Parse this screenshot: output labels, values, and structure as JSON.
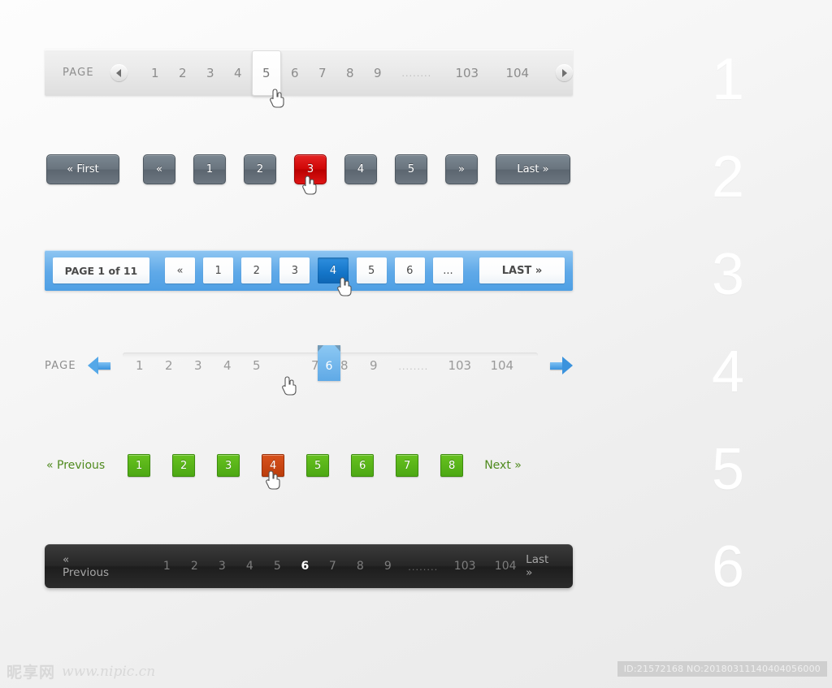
{
  "markers": [
    "1",
    "2",
    "3",
    "4",
    "5",
    "6"
  ],
  "bar1": {
    "label": "PAGE",
    "prev_icon": "circle-left-arrow-icon",
    "next_icon": "circle-right-arrow-icon",
    "pages": [
      "1",
      "2",
      "3",
      "4"
    ],
    "active": "5",
    "pages_after": [
      "6",
      "7",
      "8",
      "9"
    ],
    "ellipsis": "........",
    "tail": [
      "103",
      "104"
    ]
  },
  "bar2": {
    "first": "« First",
    "prev": "«",
    "pages": [
      "1",
      "2"
    ],
    "active": "3",
    "pages_after": [
      "4",
      "5"
    ],
    "next": "»",
    "last": "Last »",
    "active_color": "#cf0606",
    "button_color": "#69747e"
  },
  "bar3": {
    "status": "PAGE 1 of 11",
    "prev": "«",
    "pages": [
      "1",
      "2",
      "3"
    ],
    "active": "4",
    "pages_after": [
      "5",
      "6"
    ],
    "ellipsis": "...",
    "last": "LAST »",
    "bar_color": "#5fa9e8",
    "active_color": "#1475c8"
  },
  "bar4": {
    "label": "PAGE",
    "prev_icon": "blue-left-arrow-icon",
    "next_icon": "blue-right-arrow-icon",
    "pages": [
      "1",
      "2",
      "3",
      "4",
      "5"
    ],
    "active": "6",
    "pages_after": [
      "7",
      "8",
      "9"
    ],
    "ellipsis": "........",
    "tail": [
      "103",
      "104"
    ],
    "accent_color": "#5fa9e6"
  },
  "bar5": {
    "prev": "« Previous",
    "pages": [
      "1",
      "2",
      "3"
    ],
    "active": "4",
    "pages_after": [
      "5",
      "6",
      "7",
      "8"
    ],
    "next": "Next »",
    "button_color": "#4da814",
    "active_color": "#bb3d0c",
    "link_color": "#4f8a1e"
  },
  "bar6": {
    "prev": "« Previous",
    "pages": [
      "1",
      "2",
      "3",
      "4",
      "5"
    ],
    "active": "6",
    "pages_after": [
      "7",
      "8",
      "9"
    ],
    "ellipsis": "........",
    "tail": [
      "103",
      "104"
    ],
    "last": "Last »",
    "bar_color": "#262626"
  },
  "footer": {
    "logo_cn": "昵享网",
    "logo_url": "www.nipic.cn",
    "id_text": "ID:21572168 NO:20180311140404056000"
  }
}
